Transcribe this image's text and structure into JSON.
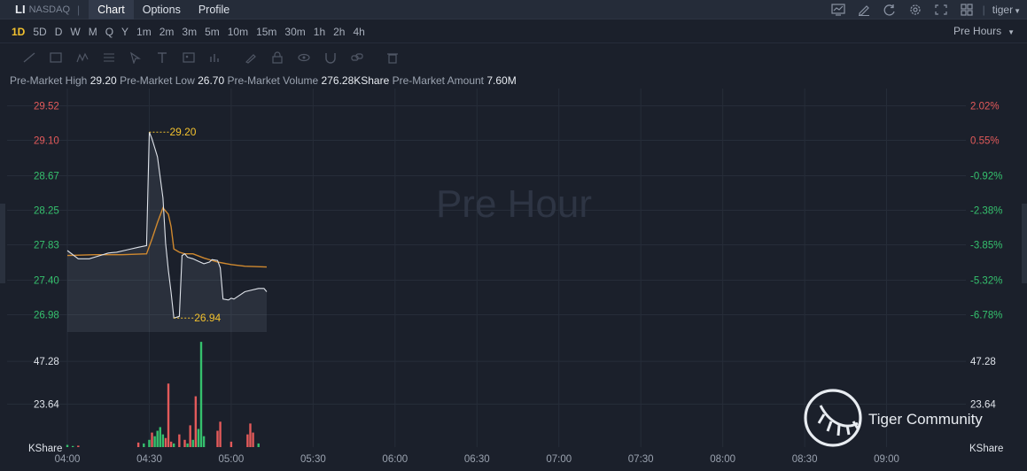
{
  "header": {
    "symbol": "LI",
    "exchange": "NASDAQ",
    "tabs": [
      {
        "label": "Chart",
        "active": true
      },
      {
        "label": "Options",
        "active": false
      },
      {
        "label": "Profile",
        "active": false
      }
    ],
    "user": "tiger",
    "icons": [
      "chart-type-icon",
      "draw-icon",
      "refresh-icon",
      "settings-icon",
      "fullscreen-icon",
      "layout-icon"
    ]
  },
  "periods": {
    "items": [
      "1D",
      "5D",
      "D",
      "W",
      "M",
      "Q",
      "Y",
      "1m",
      "2m",
      "3m",
      "5m",
      "10m",
      "15m",
      "30m",
      "1h",
      "2h",
      "4h"
    ],
    "active": "1D",
    "session_select": "Pre Hours"
  },
  "stats": [
    {
      "label": "Pre-Market High",
      "value": "29.20"
    },
    {
      "label": "Pre-Market Low",
      "value": "26.70"
    },
    {
      "label": "Pre-Market Volume",
      "value": "276.28KShare"
    },
    {
      "label": "Pre-Market Amount",
      "value": "7.60M"
    }
  ],
  "chart_data": {
    "type": "line",
    "watermark": "Pre Hour",
    "brand": "Tiger Community",
    "x_range": [
      "04:00",
      "09:30"
    ],
    "x_ticks": [
      "04:00",
      "04:30",
      "05:00",
      "05:30",
      "06:00",
      "06:30",
      "07:00",
      "07:30",
      "08:00",
      "08:30",
      "09:00"
    ],
    "y_range": [
      26.77,
      29.73
    ],
    "y_ticks": [
      "29.52",
      "29.10",
      "28.67",
      "28.25",
      "27.83",
      "27.40",
      "26.98"
    ],
    "y_tick_values": [
      29.52,
      29.1,
      28.67,
      28.25,
      27.83,
      27.4,
      26.98
    ],
    "pct_ticks": [
      "2.02%",
      "0.55%",
      "-0.92%",
      "-2.38%",
      "-3.85%",
      "-5.32%",
      "-6.78%"
    ],
    "high_label": "29.20",
    "low_label": "26.94",
    "series": [
      {
        "values_x": [
          "04:00",
          "04:04",
          "04:08",
          "04:12",
          "04:15",
          "04:18",
          "04:22",
          "04:26",
          "04:29",
          "04:30",
          "04:31",
          "04:33",
          "04:35",
          "04:36",
          "04:37",
          "04:38",
          "04:39",
          "04:40",
          "04:41",
          "04:42",
          "04:43",
          "04:44",
          "04:46",
          "04:48",
          "04:50",
          "04:52",
          "04:53",
          "04:55",
          "04:56",
          "04:57",
          "04:59",
          "05:00",
          "05:01",
          "05:05",
          "05:10",
          "05:12",
          "05:13"
        ],
        "values_y": [
          27.76,
          27.66,
          27.66,
          27.7,
          27.73,
          27.74,
          27.77,
          27.8,
          27.82,
          29.2,
          29.12,
          28.9,
          28.4,
          27.85,
          27.52,
          27.25,
          26.94,
          26.95,
          26.96,
          27.7,
          27.72,
          27.68,
          27.66,
          27.63,
          27.6,
          27.62,
          27.65,
          27.64,
          27.55,
          27.17,
          27.16,
          27.18,
          27.17,
          27.26,
          27.3,
          27.3,
          27.26
        ]
      },
      {
        "values_x": [
          "04:00",
          "04:10",
          "04:20",
          "04:29",
          "04:31",
          "04:33",
          "04:35",
          "04:37",
          "04:38",
          "04:39",
          "04:41",
          "04:43",
          "04:46",
          "04:50",
          "04:55",
          "05:00",
          "05:05",
          "05:13"
        ],
        "values_y": [
          27.7,
          27.71,
          27.71,
          27.72,
          27.9,
          28.1,
          28.28,
          28.2,
          28.05,
          27.78,
          27.74,
          27.72,
          27.72,
          27.67,
          27.62,
          27.59,
          27.57,
          27.56
        ]
      }
    ],
    "volume": {
      "y_ticks": [
        "47.28",
        "23.64"
      ],
      "y_tick_values": [
        47.28,
        23.64
      ],
      "unit": "KShare",
      "max": 60,
      "bars": [
        {
          "t": "04:00",
          "v": 1.2,
          "dir": "up"
        },
        {
          "t": "04:02",
          "v": 0.6,
          "dir": "up"
        },
        {
          "t": "04:04",
          "v": 0.8,
          "dir": "down"
        },
        {
          "t": "04:26",
          "v": 2.5,
          "dir": "down"
        },
        {
          "t": "04:28",
          "v": 2.0,
          "dir": "up"
        },
        {
          "t": "04:30",
          "v": 4.0,
          "dir": "up"
        },
        {
          "t": "04:31",
          "v": 8.0,
          "dir": "down"
        },
        {
          "t": "04:32",
          "v": 6.0,
          "dir": "up"
        },
        {
          "t": "04:33",
          "v": 9.0,
          "dir": "up"
        },
        {
          "t": "04:34",
          "v": 11.0,
          "dir": "up"
        },
        {
          "t": "04:35",
          "v": 7.0,
          "dir": "up"
        },
        {
          "t": "04:36",
          "v": 5.0,
          "dir": "down"
        },
        {
          "t": "04:37",
          "v": 35.0,
          "dir": "down"
        },
        {
          "t": "04:38",
          "v": 3.0,
          "dir": "down"
        },
        {
          "t": "04:39",
          "v": 2.0,
          "dir": "up"
        },
        {
          "t": "04:41",
          "v": 7.0,
          "dir": "down"
        },
        {
          "t": "04:43",
          "v": 4.0,
          "dir": "down"
        },
        {
          "t": "04:44",
          "v": 2.0,
          "dir": "up"
        },
        {
          "t": "04:45",
          "v": 12.0,
          "dir": "down"
        },
        {
          "t": "04:46",
          "v": 4.0,
          "dir": "up"
        },
        {
          "t": "04:47",
          "v": 28.0,
          "dir": "down"
        },
        {
          "t": "04:48",
          "v": 10.0,
          "dir": "up"
        },
        {
          "t": "04:49",
          "v": 58.0,
          "dir": "up"
        },
        {
          "t": "04:50",
          "v": 6.0,
          "dir": "up"
        },
        {
          "t": "04:55",
          "v": 9.0,
          "dir": "down"
        },
        {
          "t": "04:56",
          "v": 14.0,
          "dir": "down"
        },
        {
          "t": "05:00",
          "v": 3.0,
          "dir": "down"
        },
        {
          "t": "05:06",
          "v": 7.0,
          "dir": "down"
        },
        {
          "t": "05:07",
          "v": 13.0,
          "dir": "down"
        },
        {
          "t": "05:08",
          "v": 8.0,
          "dir": "down"
        },
        {
          "t": "05:10",
          "v": 2.0,
          "dir": "up"
        }
      ]
    }
  },
  "colors": {
    "price_line": "#dfe3ea",
    "avg_line": "#d0892f",
    "up": "#35c06d",
    "down": "#e35a5a",
    "label_yellow": "#f2c12e"
  }
}
